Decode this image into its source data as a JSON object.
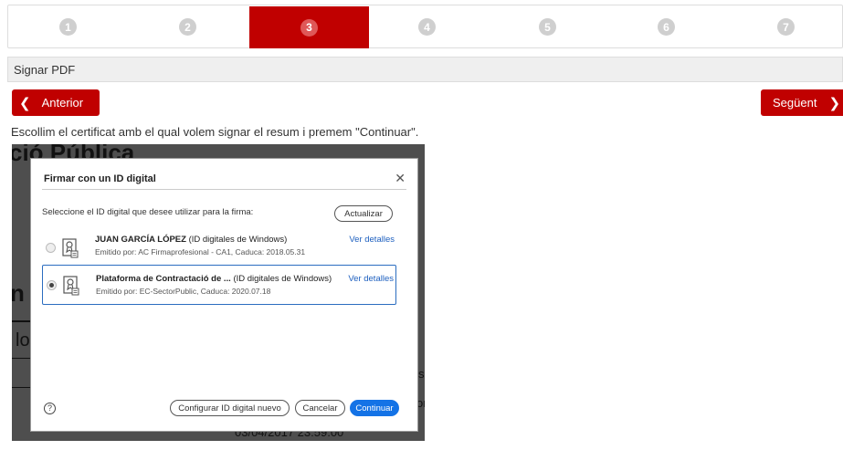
{
  "stepper": {
    "steps": [
      {
        "label": "1",
        "active": false
      },
      {
        "label": "2",
        "active": false
      },
      {
        "label": "3",
        "active": true
      },
      {
        "label": "4",
        "active": false
      },
      {
        "label": "5",
        "active": false
      },
      {
        "label": "6",
        "active": false
      },
      {
        "label": "7",
        "active": false
      }
    ]
  },
  "section": {
    "title": "Signar PDF"
  },
  "nav": {
    "prev_label": "Anterior",
    "next_label": "Següent",
    "prev_icon": "chevron-left-icon",
    "next_icon": "chevron-right-icon"
  },
  "instruction": "Escollim el certificat amb el qual volem signar el resum i premem \"Continuar\".",
  "background_doc": {
    "heading_fragment": "ció Pública",
    "frag_left_1": "n",
    "frag_left_2": "lo",
    "frag_right_1": "s",
    "frag_right_2": "or",
    "footer_fragment": "03/04/2017 23:59:00"
  },
  "dialog": {
    "title": "Firmar con un ID digital",
    "close_icon": "close-icon",
    "prompt": "Seleccione el ID digital que desee utilizar para la firma:",
    "refresh_label": "Actualizar",
    "ids": [
      {
        "name": "JUAN GARCÍA LÓPEZ",
        "type": " (ID digitales de Windows)",
        "issuer": "Emitido por: AC Firmaprofesional - CA1, Caduca: 2018.05.31",
        "details_label": "Ver detalles",
        "selected": false
      },
      {
        "name": "Plataforma de Contractació de ...",
        "type": "  (ID digitales de Windows)",
        "issuer": "Emitido por: EC-SectorPublic, Caduca: 2020.07.18",
        "details_label": "Ver detalles",
        "selected": true
      }
    ],
    "help_label": "?",
    "configure_label": "Configurar ID digital nuevo",
    "cancel_label": "Cancelar",
    "continue_label": "Continuar"
  },
  "colors": {
    "accent": "#c00000",
    "primary_blue": "#1473e6"
  }
}
